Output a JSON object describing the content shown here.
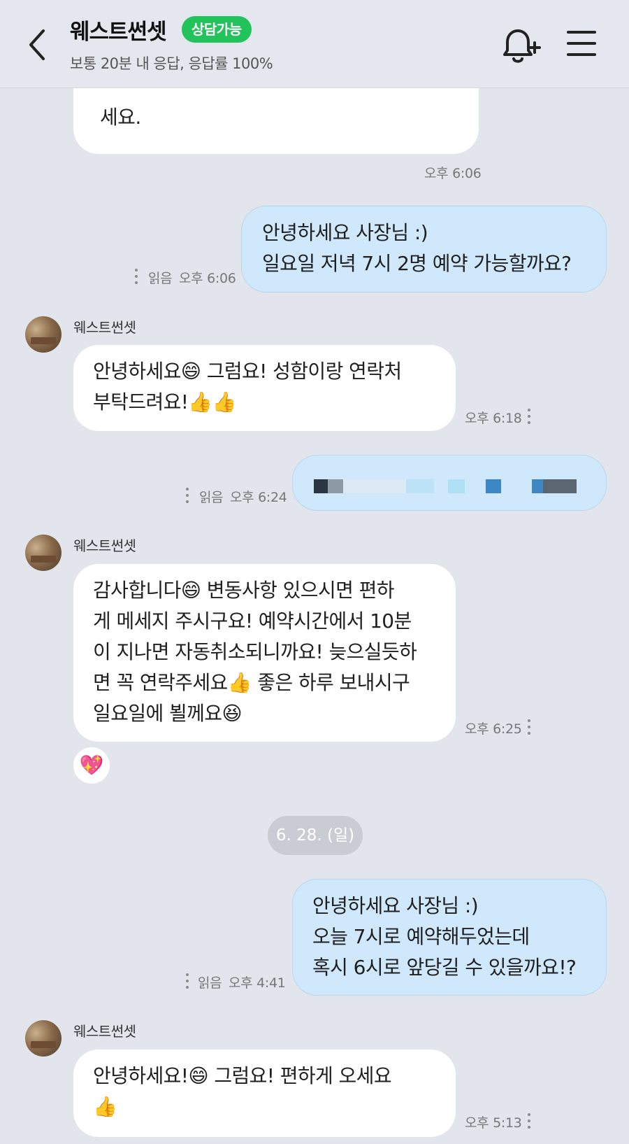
{
  "header": {
    "title": "웨스트썬셋",
    "badge": "상담가능",
    "subtitle": "보통 20분 내 응답, 응답률 100%",
    "back_icon": "chevron-left-icon",
    "bell_icon": "bell-plus-icon",
    "menu_icon": "hamburger-menu-icon"
  },
  "colors": {
    "badge": "#22c35a",
    "outgoing_bubble": "#cfe8fb",
    "incoming_bubble": "#ffffff",
    "background": "#e2e5ec"
  },
  "messages": [
    {
      "direction": "in",
      "lines": [
        "세요."
      ],
      "time": "오후 6:06"
    },
    {
      "direction": "out",
      "lines": [
        "안녕하세요 사장님 :)",
        "일요일 저녁 7시 2명 예약 가능할까요?"
      ],
      "read": "읽음",
      "time": "오후 6:06"
    },
    {
      "direction": "in",
      "sender": "웨스트썬셋",
      "lines": [
        "안녕하세요😄 그럼요! 성함이랑 연락처",
        "부탁드려요!👍👍"
      ],
      "time": "오후 6:18"
    },
    {
      "direction": "out",
      "lines": [],
      "note": "redacted",
      "read": "읽음",
      "time": "오후 6:24"
    },
    {
      "direction": "in",
      "sender": "웨스트썬셋",
      "lines": [
        "감사합니다😄 변동사항 있으시면 편하",
        "게 메세지 주시구요! 예약시간에서 10분",
        "이 지나면 자동취소되니까요! 늦으실듯하",
        "면 꼭 연락주세요👍 좋은 하루 보내시구",
        "일요일에 뵐께요😆"
      ],
      "time": "오후 6:25",
      "reaction": "💖"
    },
    {
      "direction": "date",
      "label": "6. 28. (일)"
    },
    {
      "direction": "out",
      "lines": [
        "안녕하세요 사장님 :)",
        "오늘 7시로 예약해두었는데",
        "혹시 6시로 앞당길 수 있을까요!?"
      ],
      "read": "읽음",
      "time": "오후 4:41"
    },
    {
      "direction": "in",
      "sender": "웨스트썬셋",
      "lines": [
        "안녕하세요!😄 그럼요! 편하게 오세요",
        "👍"
      ],
      "time": "오후 5:13"
    }
  ]
}
